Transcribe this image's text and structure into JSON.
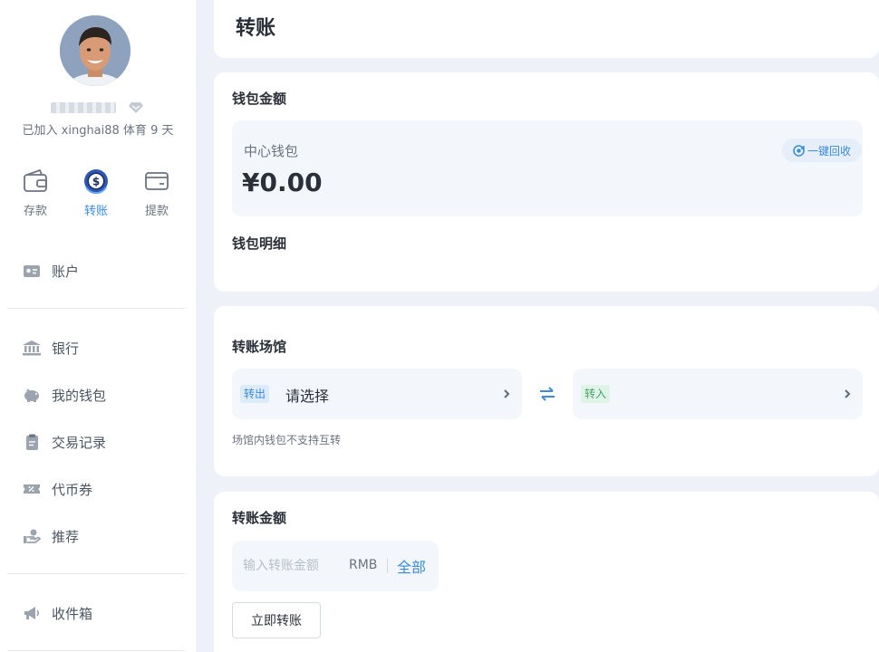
{
  "profile": {
    "joined_text": "已加入 xinghai88 体育 9 天"
  },
  "quick_actions": [
    {
      "label": "存款",
      "icon": "wallet-icon"
    },
    {
      "label": "转账",
      "icon": "transfer-coin-icon"
    },
    {
      "label": "提款",
      "icon": "card-icon"
    }
  ],
  "nav": [
    {
      "label": "账户",
      "icon": "id-card-icon"
    },
    {
      "label": "银行",
      "icon": "bank-icon"
    },
    {
      "label": "我的钱包",
      "icon": "piggy-bank-icon"
    },
    {
      "label": "交易记录",
      "icon": "clipboard-icon"
    },
    {
      "label": "代币券",
      "icon": "coupon-icon"
    },
    {
      "label": "推荐",
      "icon": "hand-coin-icon"
    },
    {
      "label": "收件箱",
      "icon": "megaphone-icon"
    }
  ],
  "page": {
    "title": "转账"
  },
  "wallet": {
    "section_title": "钱包金额",
    "name": "中心钱包",
    "amount": "¥0.00",
    "recycle_label": "一键回收",
    "details_title": "钱包明细"
  },
  "transfer": {
    "section_title": "转账场馆",
    "out_tag": "转出",
    "out_placeholder": "请选择",
    "in_tag": "转入",
    "hint": "场馆内钱包不支持互转"
  },
  "amount": {
    "section_title": "转账金额",
    "placeholder": "输入转账金额",
    "unit": "RMB",
    "all_label": "全部",
    "submit_label": "立即转账"
  },
  "colors": {
    "accent": "#3a8bdc",
    "background": "#eef2f8",
    "in_tag": "#4aa06c"
  }
}
